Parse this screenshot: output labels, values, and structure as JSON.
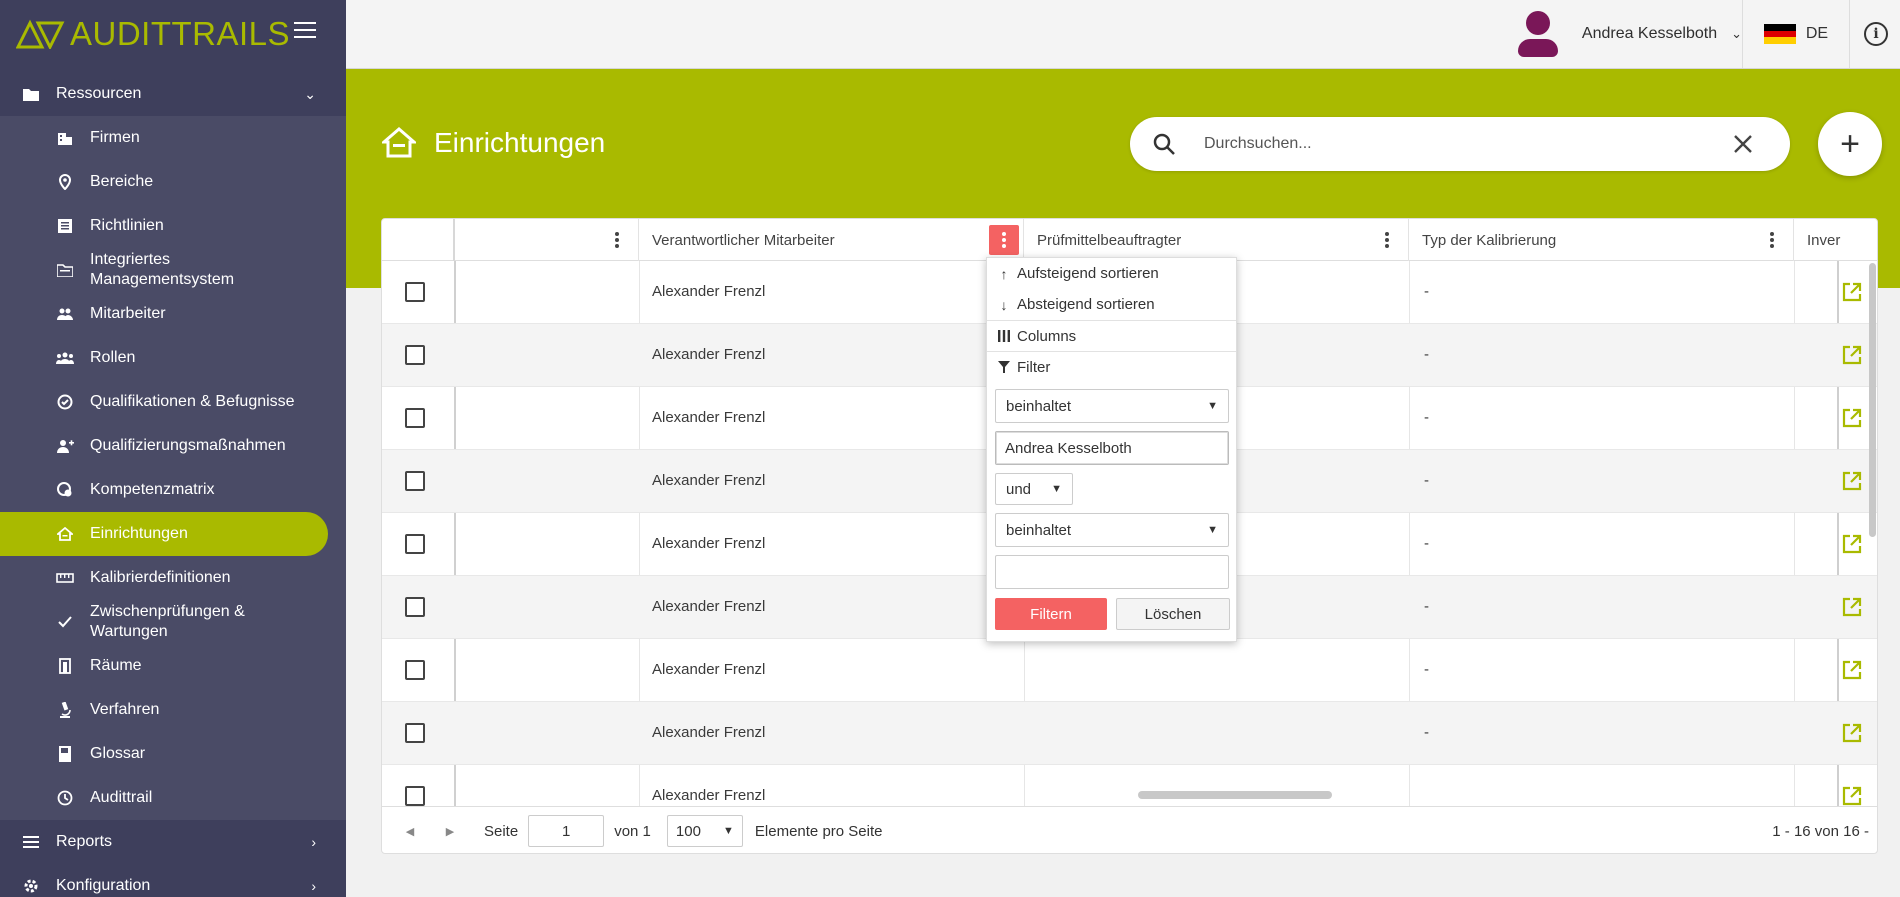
{
  "app": {
    "logo_audit": "AUDIT",
    "logo_trails": "TRAILS"
  },
  "sidebar": {
    "group_resources": "Ressourcen",
    "items": [
      {
        "label": "Firmen",
        "icon": "building-icon"
      },
      {
        "label": "Bereiche",
        "icon": "location-pin-icon"
      },
      {
        "label": "Richtlinien",
        "icon": "document-list-icon"
      },
      {
        "label": "Integriertes Managementsystem",
        "icon": "folder-open-icon"
      },
      {
        "label": "Mitarbeiter",
        "icon": "people-icon"
      },
      {
        "label": "Rollen",
        "icon": "group-icon"
      },
      {
        "label": "Qualifikationen & Befugnisse",
        "icon": "badge-icon"
      },
      {
        "label": "Qualifizierungsmaßnahmen",
        "icon": "person-add-icon"
      },
      {
        "label": "Kompetenzmatrix",
        "icon": "matrix-icon"
      },
      {
        "label": "Einrichtungen",
        "icon": "home-icon"
      },
      {
        "label": "Kalibrierdefinitionen",
        "icon": "ruler-icon"
      },
      {
        "label": "Zwischenprüfungen & Wartungen",
        "icon": "check-icon"
      },
      {
        "label": "Räume",
        "icon": "room-icon"
      },
      {
        "label": "Verfahren",
        "icon": "microscope-icon"
      },
      {
        "label": "Glossar",
        "icon": "book-icon"
      },
      {
        "label": "Audittrail",
        "icon": "clock-icon"
      }
    ],
    "group_reports": "Reports",
    "group_config": "Konfiguration",
    "active_color": "#a9ba00",
    "bg_color": "#3e3f5c"
  },
  "topbar": {
    "user_name": "Andrea Kesselboth",
    "lang": "DE"
  },
  "page": {
    "title": "Einrichtungen",
    "search_placeholder": "Durchsuchen..."
  },
  "grid": {
    "columns": [
      "Verantwortlicher Mitarbeiter",
      "Prüfmittelbeauftragter",
      "Typ der Kalibrierung",
      "Inver"
    ],
    "rows": [
      {
        "mitarbeiter": "Alexander Frenzl",
        "typ": "-"
      },
      {
        "mitarbeiter": "Alexander Frenzl",
        "typ": "-"
      },
      {
        "mitarbeiter": "Alexander Frenzl",
        "typ": "-"
      },
      {
        "mitarbeiter": "Alexander Frenzl",
        "typ": "-"
      },
      {
        "mitarbeiter": "Alexander Frenzl",
        "typ": "-"
      },
      {
        "mitarbeiter": "Alexander Frenzl",
        "typ": "-"
      },
      {
        "mitarbeiter": "Alexander Frenzl",
        "typ": "-"
      },
      {
        "mitarbeiter": "Alexander Frenzl",
        "typ": "-"
      },
      {
        "mitarbeiter": "Alexander Frenzl",
        "typ": ""
      }
    ]
  },
  "pager": {
    "page_label": "Seite",
    "page_value": "1",
    "of_label": "von 1",
    "page_size": "100",
    "per_page_label": "Elemente pro Seite",
    "summary": "1 - 16 von 16 -"
  },
  "column_menu": {
    "sort_asc": "Aufsteigend sortieren",
    "sort_desc": "Absteigend sortieren",
    "columns": "Columns",
    "filter": "Filter",
    "operator1": "beinhaltet",
    "value1": "Andrea Kesselboth",
    "join": "und",
    "operator2": "beinhaltet",
    "value2": "",
    "filter_button": "Filtern",
    "clear_button": "Löschen",
    "accent_color": "#f46262"
  }
}
